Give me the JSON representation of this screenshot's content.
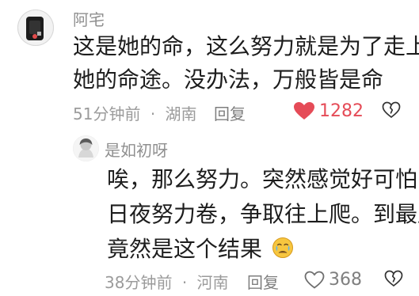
{
  "comments": [
    {
      "author": "阿宅",
      "content_lines": [
        "这是她的命，这么努力就是为了走上",
        "她的命途。没办法，万般皆是命"
      ],
      "time": "51分钟前",
      "separator": "·",
      "location": "湖南",
      "reply_label": "回复",
      "likes": "1282",
      "liked": true,
      "avatar_icon": "dark-device-avatar-icon",
      "like_icon": "heart-filled-icon",
      "dislike_icon": "broken-heart-icon",
      "like_color": "#e54b57"
    },
    {
      "author": "是如初呀",
      "content_lines": [
        "唉，那么努力。突然感觉好可怕，",
        "日夜努力卷，争取往上爬。到最后",
        "竟然是这个结果"
      ],
      "emoji_icon": "crying-face-icon",
      "time": "38分钟前",
      "separator": "·",
      "location": "河南",
      "reply_label": "回复",
      "likes": "368",
      "liked": false,
      "avatar_icon": "anime-avatar-icon",
      "like_icon": "heart-outline-icon",
      "dislike_icon": "broken-heart-icon"
    }
  ]
}
